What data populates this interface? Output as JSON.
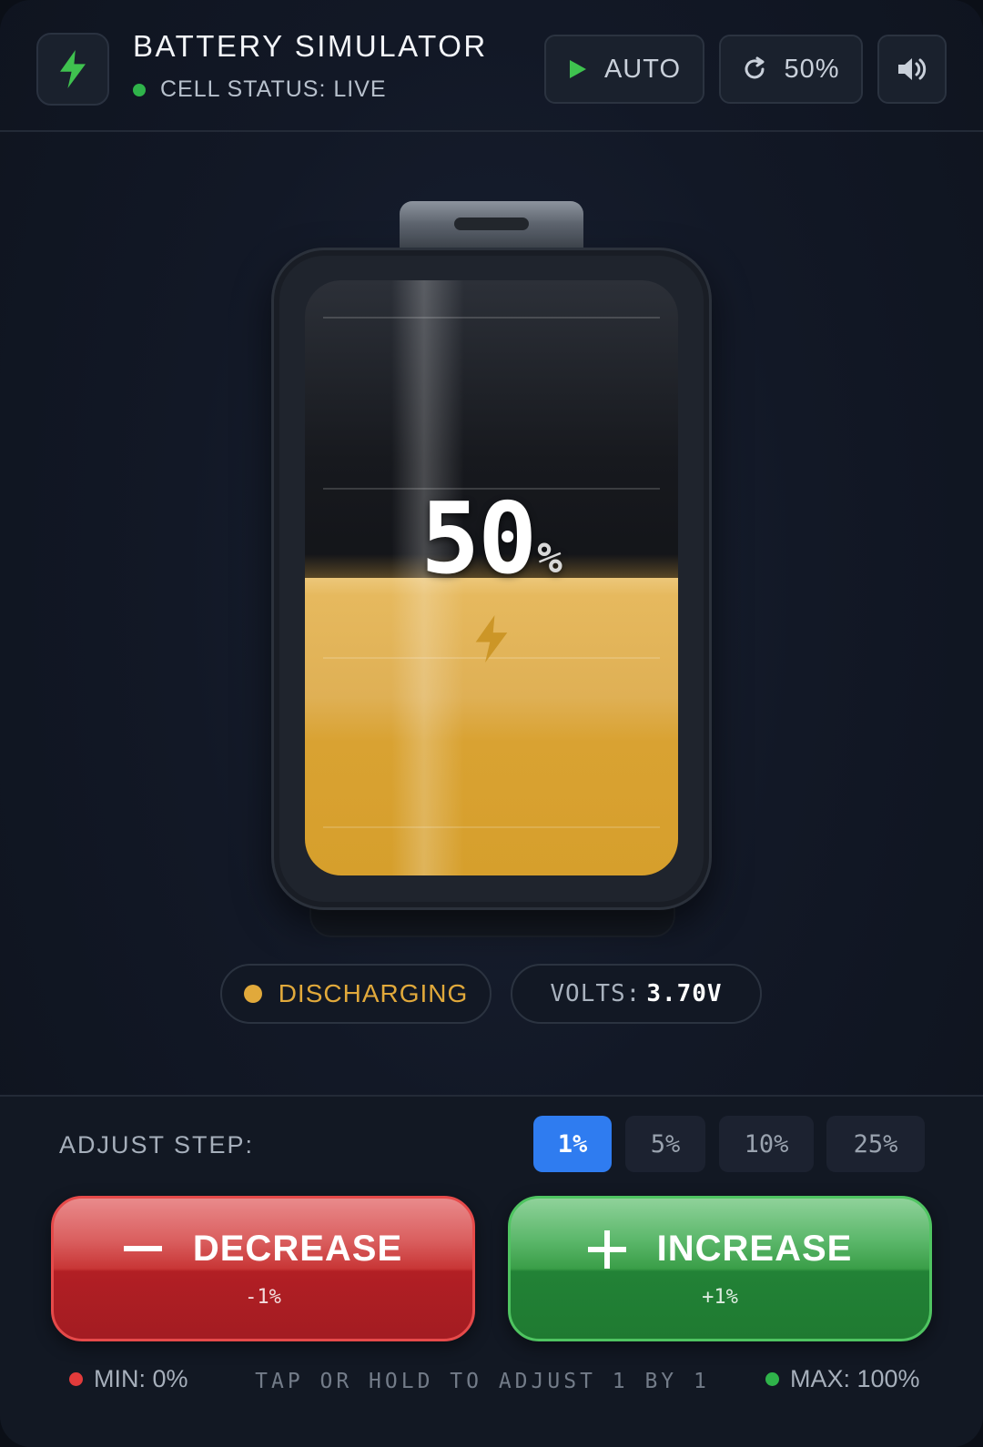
{
  "header": {
    "title": "BATTERY SIMULATOR",
    "status": "CELL STATUS: LIVE",
    "auto_label": "AUTO",
    "reset_label": "50%",
    "icons": {
      "logo": "bolt-icon",
      "auto": "play-icon",
      "reset": "refresh-icon",
      "sound": "speaker-icon"
    }
  },
  "battery": {
    "level_value": "50",
    "level_sign": "%",
    "level_fraction": 0.5,
    "fill_color": "#d9a232"
  },
  "badges": {
    "state": "DISCHARGING",
    "volts_label": "VOLTS:",
    "volts_value": "3.70V"
  },
  "controls": {
    "step_label": "ADJUST STEP:",
    "steps": [
      "1%",
      "5%",
      "10%",
      "25%"
    ],
    "active_step": "1%",
    "decrease_label": "DECREASE",
    "decrease_sub": "-1%",
    "increase_label": "INCREASE",
    "increase_sub": "+1%"
  },
  "footer": {
    "min": "MIN: 0%",
    "hint": "TAP OR HOLD TO ADJUST 1 BY 1",
    "max": "MAX: 100%"
  },
  "colors": {
    "accent_blue": "#2f7cf0",
    "status_green": "#2fb34a",
    "warning_amber": "#e1a93b",
    "danger_red": "#e23b3b"
  }
}
